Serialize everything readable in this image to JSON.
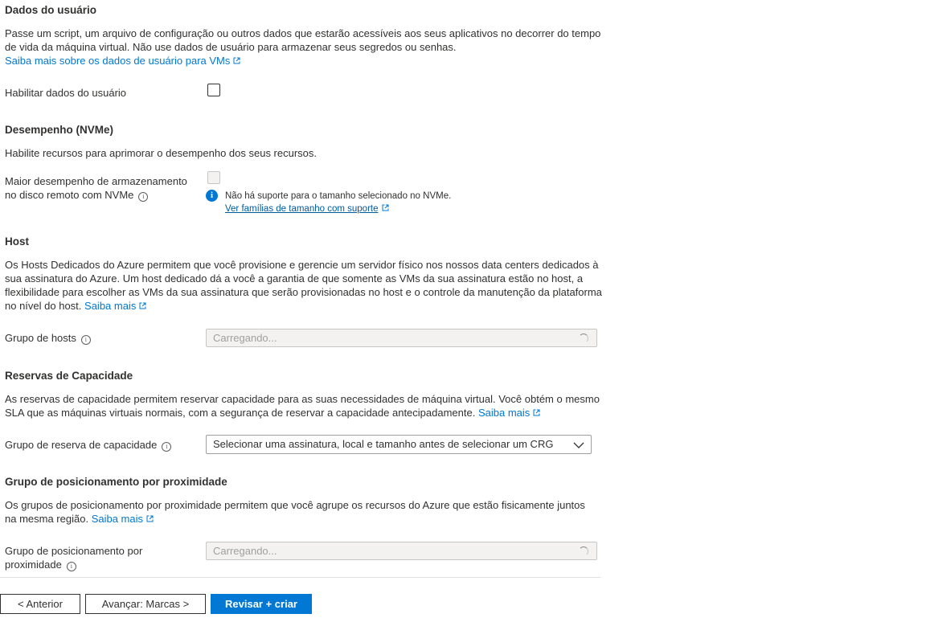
{
  "user_data": {
    "title": "Dados do usuário",
    "desc_line1": "Passe um script, um arquivo de configuração ou outros dados que estarão acessíveis aos seus aplicativos no decorrer do tempo",
    "desc_line2": "de vida da máquina virtual. Não use dados de usuário para armazenar seus segredos ou senhas.",
    "learn_more": "Saiba mais sobre os dados de usuário para VMs",
    "enable_label": "Habilitar dados do usuário"
  },
  "performance": {
    "title": "Desempenho (NVMe)",
    "desc": "Habilite recursos para aprimorar o desempenho dos seus recursos.",
    "label_line1": "Maior desempenho de armazenamento",
    "label_line2": "no disco remoto com NVMe",
    "info_message": "Não há suporte para o tamanho selecionado no NVMe.",
    "info_link": "Ver famílias de tamanho com suporte"
  },
  "host": {
    "title": "Host",
    "desc_line1": "Os Hosts Dedicados do Azure permitem que você provisione e gerencie um servidor físico nos nossos data centers dedicados à",
    "desc_line2": "sua assinatura do Azure. Um host dedicado dá a você a garantia de que somente as VMs da sua assinatura estão no host, a",
    "desc_line3": "flexibilidade para escolher as VMs da sua assinatura que serão provisionadas no host e o controle da manutenção da plataforma",
    "desc_line4": "no nível do host.",
    "learn_more": "Saiba mais",
    "group_label": "Grupo de hosts",
    "group_placeholder": "Carregando..."
  },
  "capacity": {
    "title": "Reservas de Capacidade",
    "desc_line1": "As reservas de capacidade permitem reservar capacidade para as suas necessidades de máquina virtual. Você obtém o mesmo",
    "desc_line2": "SLA que as máquinas virtuais normais, com a segurança de reservar a capacidade antecipadamente.",
    "learn_more": "Saiba mais",
    "group_label": "Grupo de reserva de capacidade",
    "group_value": "Selecionar uma assinatura, local e tamanho antes de selecionar um CRG"
  },
  "proximity": {
    "title": "Grupo de posicionamento por proximidade",
    "desc_line1": "Os grupos de posicionamento por proximidade permitem que você agrupe os recursos do Azure que estão fisicamente juntos",
    "desc_line2": "na mesma região.",
    "learn_more": "Saiba mais",
    "label_line1": "Grupo de posicionamento por",
    "label_line2": "proximidade",
    "placeholder": "Carregando..."
  },
  "footer": {
    "prev": "< Anterior",
    "next": "Avançar: Marcas >",
    "create": "Revisar + criar"
  },
  "colors": {
    "accent": "#0078d4",
    "text": "#323130",
    "disabled": "#f3f2f1"
  }
}
